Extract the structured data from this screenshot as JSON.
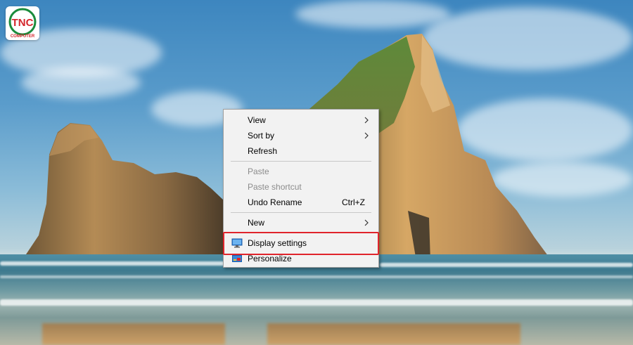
{
  "logo": {
    "brand": "TNC",
    "sub": "COMPUTER",
    "color_primary": "#d4262c",
    "color_secondary": "#1a8b3b"
  },
  "context_menu": {
    "items": [
      {
        "label": "View",
        "shortcut": "",
        "submenu": true,
        "enabled": true
      },
      {
        "label": "Sort by",
        "shortcut": "",
        "submenu": true,
        "enabled": true
      },
      {
        "label": "Refresh",
        "shortcut": "",
        "submenu": false,
        "enabled": true
      },
      {
        "label": "Paste",
        "shortcut": "",
        "submenu": false,
        "enabled": false
      },
      {
        "label": "Paste shortcut",
        "shortcut": "",
        "submenu": false,
        "enabled": false
      },
      {
        "label": "Undo Rename",
        "shortcut": "Ctrl+Z",
        "submenu": false,
        "enabled": true
      },
      {
        "label": "New",
        "shortcut": "",
        "submenu": true,
        "enabled": true
      },
      {
        "label": "Display settings",
        "shortcut": "",
        "submenu": false,
        "enabled": true,
        "icon": "display-icon",
        "highlighted": true
      },
      {
        "label": "Personalize",
        "shortcut": "",
        "submenu": false,
        "enabled": true,
        "icon": "personalize-icon"
      }
    ],
    "highlight_color": "#e0242c"
  }
}
